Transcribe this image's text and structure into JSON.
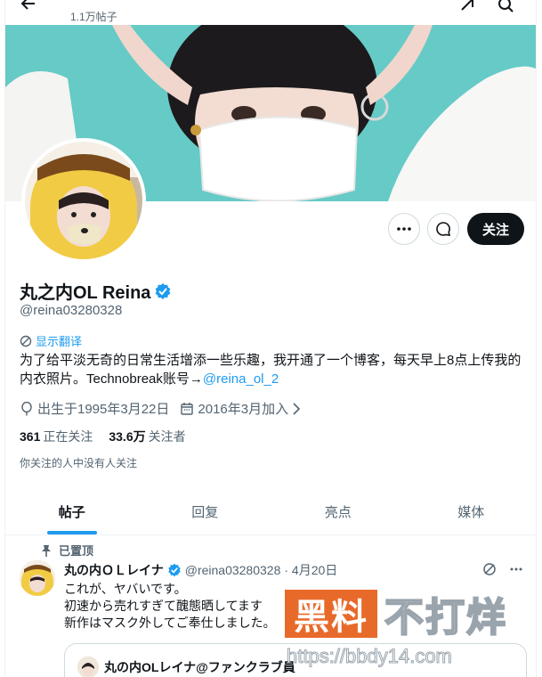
{
  "header": {
    "post_count": "1.1万帖子"
  },
  "profile": {
    "display_name": "丸之内OL Reina",
    "handle": "@reina03280328",
    "translate_label": "显示翻译",
    "bio_text": "为了给平淡无奇的日常生活增添一些乐趣，我开通了一个博客，每天早上8点上传我的内衣照片。Technobreak账号→",
    "bio_link": "@reina_ol_2",
    "birthday": "出生于1995年3月22日",
    "joined": "2016年3月加入",
    "following_count": "361",
    "following_label": "正在关注",
    "followers_count": "33.6万",
    "followers_label": "关注者",
    "no_mutuals": "你关注的人中没有人关注",
    "follow_button": "关注"
  },
  "tabs": [
    {
      "label": "帖子",
      "active": true
    },
    {
      "label": "回复",
      "active": false
    },
    {
      "label": "亮点",
      "active": false
    },
    {
      "label": "媒体",
      "active": false
    }
  ],
  "pinned_post": {
    "pinned_label": "已置顶",
    "author_name": "丸の内ＯＬレイナ",
    "author_handle": "@reina03280328",
    "date": "· 4月20日",
    "lines": [
      "これが、ヤバいです。",
      "初速から売れすぎて醜態晒してます",
      "新作はマスク外してご奉仕しました。"
    ],
    "quote_name": "丸の内OLレイナ@ファンクラブ員"
  },
  "watermark": {
    "box_text": "黑料",
    "text": "不打烊",
    "url": "https://bbdy14.com"
  },
  "colors": {
    "accent": "#1d9bf0",
    "text": "#0f1419",
    "muted": "#536471",
    "verified": "#1d9bf0",
    "banner": "#5ec8c6"
  }
}
